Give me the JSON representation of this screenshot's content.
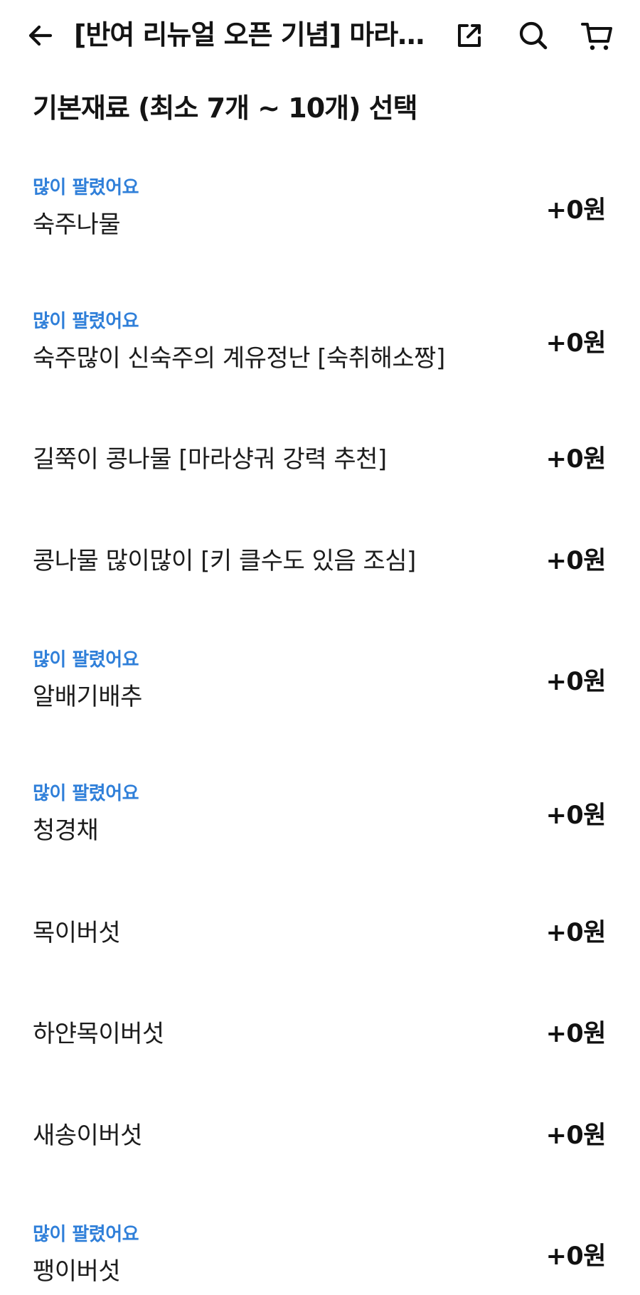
{
  "header": {
    "title": "[반여 리뉴얼 오픈 기념] 마라탕...",
    "back_icon": "arrow-left-icon",
    "share_icon": "share-external-icon",
    "search_icon": "search-icon",
    "cart_icon": "cart-icon"
  },
  "section": {
    "title": "기본재료 (최소 7개 ~ 10개) 선택"
  },
  "accent_color": "#2f7fd9",
  "options": [
    {
      "badge": "많이 팔렸어요",
      "name": "숙주나물",
      "price": "+0원"
    },
    {
      "badge": "많이 팔렸어요",
      "name": "숙주많이 신숙주의 계유정난 [숙취해소짱]",
      "price": "+0원"
    },
    {
      "badge": "",
      "name": "길쭉이 콩나물 [마라샹궈 강력 추천]",
      "price": "+0원"
    },
    {
      "badge": "",
      "name": "콩나물 많이많이 [키 클수도 있음 조심]",
      "price": "+0원"
    },
    {
      "badge": "많이 팔렸어요",
      "name": "알배기배추",
      "price": "+0원"
    },
    {
      "badge": "많이 팔렸어요",
      "name": "청경채",
      "price": "+0원"
    },
    {
      "badge": "",
      "name": "목이버섯",
      "price": "+0원"
    },
    {
      "badge": "",
      "name": "하얀목이버섯",
      "price": "+0원"
    },
    {
      "badge": "",
      "name": "새송이버섯",
      "price": "+0원"
    },
    {
      "badge": "많이 팔렸어요",
      "name": "팽이버섯",
      "price": "+0원"
    }
  ]
}
